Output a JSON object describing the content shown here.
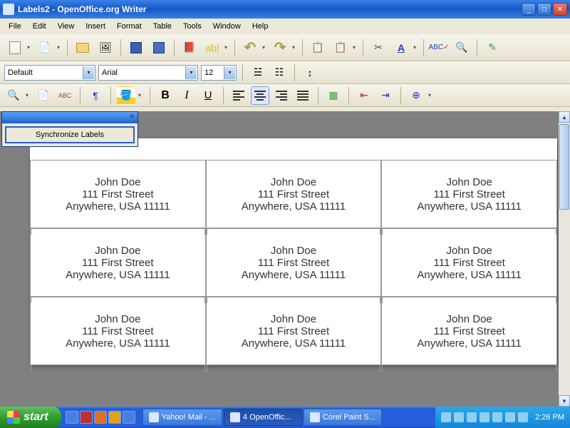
{
  "window": {
    "title": "Labels2 - OpenOffice.org Writer"
  },
  "menu": {
    "items": [
      "File",
      "Edit",
      "View",
      "Insert",
      "Format",
      "Table",
      "Tools",
      "Window",
      "Help"
    ]
  },
  "format_bar": {
    "style": "Default",
    "font": "Arial",
    "size": "12"
  },
  "sync": {
    "button": "Synchronize Labels"
  },
  "labels": {
    "name": "John Doe",
    "street": "111 First Street",
    "city": "Anywhere, USA 11111"
  },
  "taskbar": {
    "start": "start",
    "tasks": [
      {
        "label": "Yahoo! Mail - ...",
        "active": false
      },
      {
        "label": "4 OpenOffic...",
        "active": true,
        "prefix": "4 "
      },
      {
        "label": "Corel Paint S...",
        "active": false
      }
    ],
    "clock": "2:26 PM"
  },
  "colors": {
    "xp_blue": "#245edb",
    "xp_green": "#2f9e2f",
    "toolbar_bg": "#ece9d8"
  }
}
